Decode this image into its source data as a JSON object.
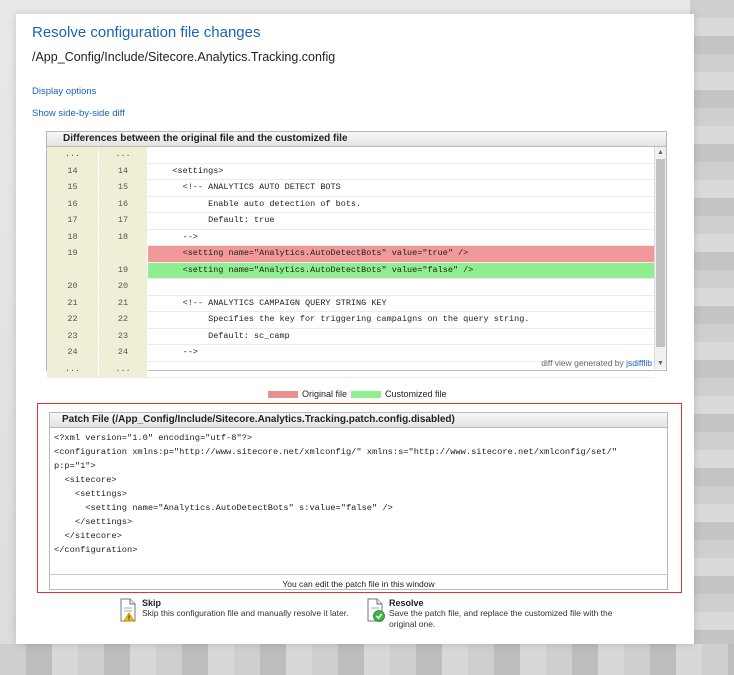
{
  "page": {
    "title": "Resolve configuration file changes",
    "file_path": "/App_Config/Include/Sitecore.Analytics.Tracking.config",
    "display_options_label": "Display options",
    "side_by_side_label": "Show side-by-side diff"
  },
  "diff": {
    "header": "Differences between the original file and the customized file",
    "rows": [
      {
        "left": "...",
        "right": "...",
        "text": "",
        "type": "ellipsis"
      },
      {
        "left": "14",
        "right": "14",
        "text": "    <settings>",
        "type": "normal"
      },
      {
        "left": "15",
        "right": "15",
        "text": "      <!-- ANALYTICS AUTO DETECT BOTS",
        "type": "normal"
      },
      {
        "left": "16",
        "right": "16",
        "text": "           Enable auto detection of bots.",
        "type": "normal"
      },
      {
        "left": "17",
        "right": "17",
        "text": "           Default: true",
        "type": "normal"
      },
      {
        "left": "18",
        "right": "18",
        "text": "      -->",
        "type": "normal"
      },
      {
        "left": "19",
        "right": "",
        "text": "      <setting name=\"Analytics.AutoDetectBots\" value=\"true\" />",
        "type": "removed"
      },
      {
        "left": "",
        "right": "19",
        "text": "      <setting name=\"Analytics.AutoDetectBots\" value=\"false\" />",
        "type": "added"
      },
      {
        "left": "20",
        "right": "20",
        "text": "",
        "type": "normal"
      },
      {
        "left": "21",
        "right": "21",
        "text": "      <!-- ANALYTICS CAMPAIGN QUERY STRING KEY",
        "type": "normal"
      },
      {
        "left": "22",
        "right": "22",
        "text": "           Specifies the key for triggering campaigns on the query string.",
        "type": "normal"
      },
      {
        "left": "23",
        "right": "23",
        "text": "           Default: sc_camp",
        "type": "normal"
      },
      {
        "left": "24",
        "right": "24",
        "text": "      -->",
        "type": "normal"
      },
      {
        "left": "...",
        "right": "...",
        "text": "",
        "type": "ellipsis"
      }
    ],
    "generated_prefix": "diff view generated by",
    "generated_link": "jsdifflib"
  },
  "legend": {
    "original_label": "Original file",
    "customized_label": "Customized file",
    "original_color": "#e88f8f",
    "customized_color": "#8ef08e"
  },
  "patch": {
    "header": "Patch File (/App_Config/Include/Sitecore.Analytics.Tracking.patch.config.disabled)",
    "content": "<?xml version=\"1.0\" encoding=\"utf-8\"?>\n<configuration xmlns:p=\"http://www.sitecore.net/xmlconfig/\" xmlns:s=\"http://www.sitecore.net/xmlconfig/set/\"\np:p=\"1\">\n  <sitecore>\n    <settings>\n      <setting name=\"Analytics.AutoDetectBots\" s:value=\"false\" />\n    </settings>\n  </sitecore>\n</configuration>",
    "note": "You can edit the patch file in this window"
  },
  "actions": {
    "skip": {
      "label": "Skip",
      "description": "Skip this configuration file and manually resolve it later."
    },
    "resolve": {
      "label": "Resolve",
      "description": "Save the patch file, and replace the customized file with the original one."
    }
  }
}
